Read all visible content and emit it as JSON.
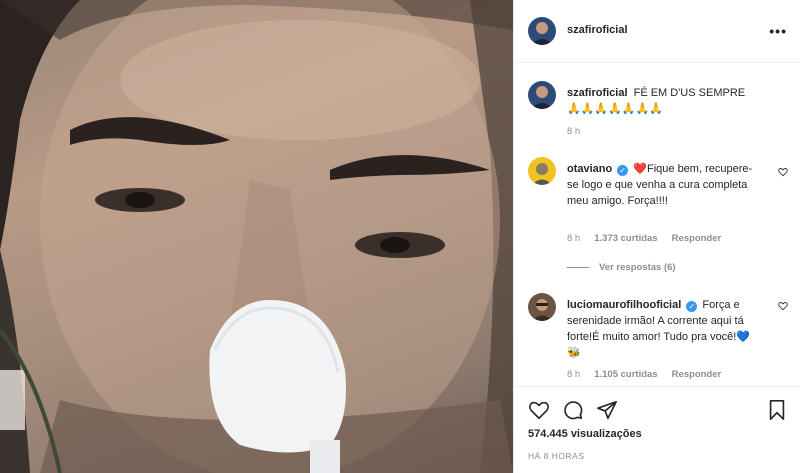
{
  "post": {
    "author": "szafiroficial"
  },
  "caption": {
    "username": "szafiroficial",
    "text": "FÉ EM D'US SEMPRE",
    "emojis": "🙏🙏🙏🙏🙏🙏🙏",
    "time": "8 h"
  },
  "comments": [
    {
      "username": "otaviano",
      "verified": true,
      "text": "❤️Fique bem, recupere-se logo e que venha a cura completa meu amigo. Força!!!!",
      "time": "8 h",
      "likes": "1.373 curtidas",
      "reply_label": "Responder",
      "view_replies": "Ver respostas (6)"
    },
    {
      "username": "luciomaurofilhooficial",
      "verified": true,
      "text": "Força e serenidade irmão! A corrente aqui tá forte!É muito amor! Tudo pra você!💙🐝",
      "time": "8 h",
      "likes": "1.105 curtidas",
      "reply_label": "Responder"
    }
  ],
  "footer": {
    "views": "574.445 visualizações",
    "posted": "HÁ 8 HORAS"
  },
  "icons": {
    "more": "more-options-icon",
    "like": "heart-icon",
    "comment": "comment-icon",
    "share": "paper-plane-icon",
    "save": "bookmark-icon"
  },
  "colors": {
    "verified": "#3897f0",
    "muted": "#8e8e8e",
    "text": "#262626",
    "border": "#efefef"
  }
}
